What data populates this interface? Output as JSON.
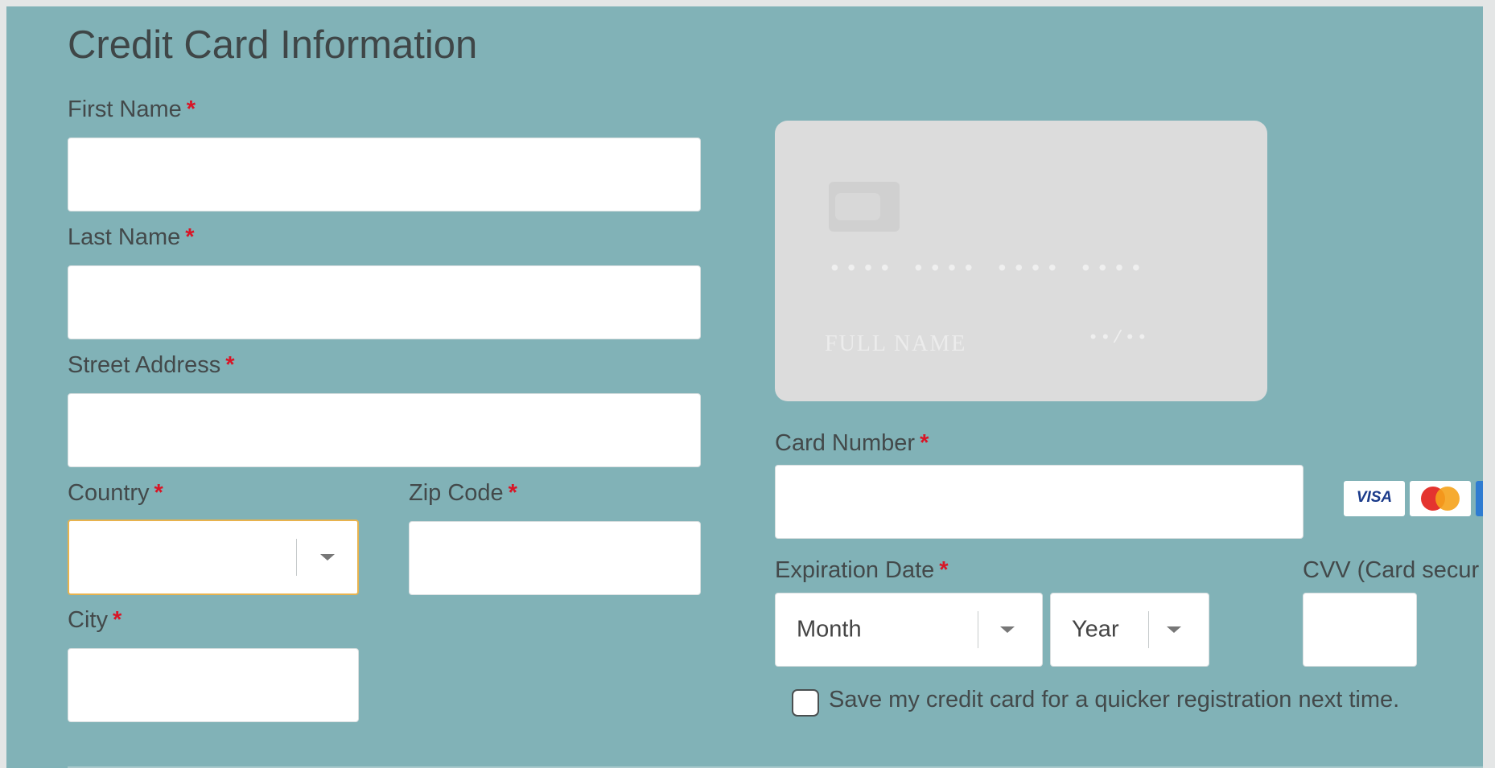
{
  "form": {
    "title": "Credit Card Information",
    "required_marker": "*",
    "first_name": {
      "label": "First Name",
      "value": ""
    },
    "last_name": {
      "label": "Last Name",
      "value": ""
    },
    "street_address": {
      "label": "Street Address",
      "value": ""
    },
    "country": {
      "label": "Country",
      "value": ""
    },
    "zip_code": {
      "label": "Zip Code",
      "value": ""
    },
    "city": {
      "label": "City",
      "value": ""
    },
    "card_number": {
      "label": "Card Number",
      "value": ""
    },
    "expiration_date": {
      "label": "Expiration Date",
      "month": "Month",
      "year": "Year"
    },
    "cvv": {
      "label": "CVV (Card secur",
      "value": ""
    },
    "save_card": {
      "label": "Save my credit card for a quicker registration next time.",
      "checked": false
    }
  },
  "card_preview": {
    "number_mask": "•••• •••• •••• ••••",
    "name_placeholder": "FULL NAME",
    "expiry_mask": "••/••"
  },
  "card_brands": {
    "visa": "VISA"
  },
  "colors": {
    "panel_background": "#81b2b7",
    "required_marker": "#d81526",
    "focus_border": "#e8b34e",
    "card_preview": "#dcdcdc"
  },
  "icons": [
    "chip-icon",
    "visa-icon",
    "mastercard-icon",
    "amex-icon",
    "chevron-down-icon"
  ]
}
